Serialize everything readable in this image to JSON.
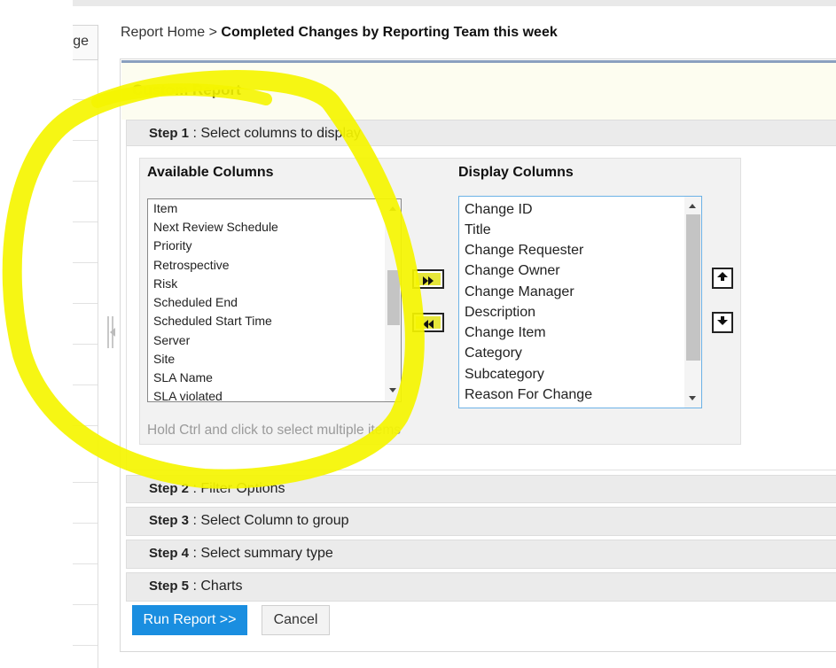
{
  "left_nav": {
    "tab_label": "ge"
  },
  "breadcrumb": {
    "home": "Report Home",
    "separator": ">",
    "current": "Completed Changes by Reporting Team this week"
  },
  "report": {
    "title": "Custom Report"
  },
  "steps": [
    {
      "num": "Step 1",
      "label": ": Select columns to display"
    },
    {
      "num": "Step 2",
      "label": ": Filter Options"
    },
    {
      "num": "Step 3",
      "label": ": Select Column to group"
    },
    {
      "num": "Step 4",
      "label": ": Select summary type"
    },
    {
      "num": "Step 5",
      "label": ": Charts"
    }
  ],
  "available_columns": {
    "heading": "Available Columns",
    "items": [
      "Item",
      "Next Review Schedule",
      "Priority",
      "Retrospective",
      "Risk",
      "Scheduled End",
      "Scheduled Start Time",
      "Server",
      "Site",
      "SLA Name",
      "SLA violated"
    ]
  },
  "display_columns": {
    "heading": "Display Columns",
    "items": [
      "Change ID",
      "Title",
      "Change Requester",
      "Change Owner",
      "Change Manager",
      "Description",
      "Change Item",
      "Category",
      "Subcategory",
      "Reason For Change"
    ]
  },
  "hint": "Hold Ctrl and click to select multiple items",
  "actions": {
    "run": "Run Report >>",
    "cancel": "Cancel"
  },
  "icons": {
    "add": "double-right-arrow-icon",
    "remove": "double-left-arrow-icon",
    "move_up": "arrow-up-icon",
    "move_down": "arrow-down-icon",
    "resize": "collapse-handle-icon"
  },
  "colors": {
    "accent": "#1a8ee0",
    "highlight_annotation": "#f5f500",
    "header_bg": "#fdfdf0",
    "step_bg": "#ebebeb"
  }
}
